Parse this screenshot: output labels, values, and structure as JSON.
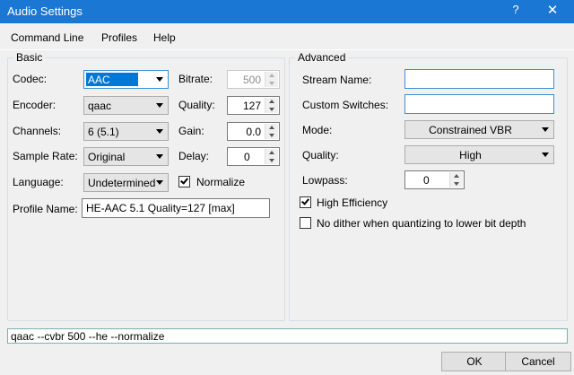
{
  "window": {
    "title": "Audio Settings",
    "help_glyph": "?",
    "close_glyph": "✕"
  },
  "menu": {
    "items": [
      "Command Line",
      "Profiles",
      "Help"
    ]
  },
  "basic": {
    "title": "Basic",
    "codec": {
      "label": "Codec:",
      "value": "AAC"
    },
    "encoder": {
      "label": "Encoder:",
      "value": "qaac"
    },
    "channels": {
      "label": "Channels:",
      "value": "6 (5.1)"
    },
    "sample_rate": {
      "label": "Sample Rate:",
      "value": "Original"
    },
    "language": {
      "label": "Language:",
      "value": "Undetermined"
    },
    "bitrate": {
      "label": "Bitrate:",
      "value": "500",
      "enabled": false
    },
    "quality": {
      "label": "Quality:",
      "value": "127"
    },
    "gain": {
      "label": "Gain:",
      "value": "0.0"
    },
    "delay": {
      "label": "Delay:",
      "value": "0"
    },
    "normalize": {
      "label": "Normalize",
      "checked": true
    },
    "profile_name": {
      "label": "Profile Name:",
      "value": "HE-AAC 5.1 Quality=127 [max]"
    }
  },
  "advanced": {
    "title": "Advanced",
    "stream_name": {
      "label": "Stream Name:",
      "value": ""
    },
    "custom_switches": {
      "label": "Custom Switches:",
      "value": ""
    },
    "mode": {
      "label": "Mode:",
      "value": "Constrained VBR"
    },
    "quality": {
      "label": "Quality:",
      "value": "High"
    },
    "lowpass": {
      "label": "Lowpass:",
      "value": "0"
    },
    "high_efficiency": {
      "label": "High Efficiency",
      "checked": true
    },
    "no_dither": {
      "label": "No dither when quantizing to lower bit depth",
      "checked": false
    }
  },
  "command_line": "qaac --cvbr 500 --he --normalize",
  "buttons": {
    "ok": "OK",
    "cancel": "Cancel"
  },
  "colors": {
    "titlebar": "#1a78d4",
    "selection": "#0078d7"
  }
}
